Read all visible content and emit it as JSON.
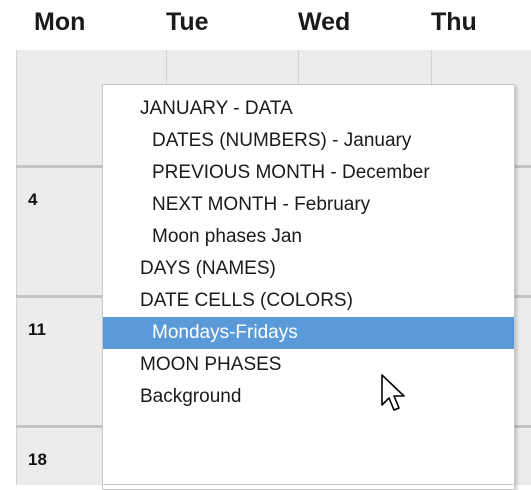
{
  "header": {
    "days": [
      "Mon",
      "Tue",
      "Wed",
      "Thu"
    ]
  },
  "calendar": {
    "date_numbers": [
      "4",
      "11",
      "18"
    ]
  },
  "context_menu": {
    "items": [
      {
        "label": "JANUARY - DATA",
        "level": 0,
        "selected": false
      },
      {
        "label": "DATES (NUMBERS) - January",
        "level": 1,
        "selected": false
      },
      {
        "label": "PREVIOUS MONTH - December",
        "level": 1,
        "selected": false
      },
      {
        "label": "NEXT MONTH - February",
        "level": 1,
        "selected": false
      },
      {
        "label": "Moon phases Jan",
        "level": 1,
        "selected": false
      },
      {
        "label": "DAYS (NAMES)",
        "level": 0,
        "selected": false
      },
      {
        "label": "DATE CELLS (COLORS)",
        "level": 0,
        "selected": false
      },
      {
        "label": "Mondays-Fridays",
        "level": 1,
        "selected": true
      },
      {
        "label": "MOON PHASES",
        "level": 0,
        "selected": false
      },
      {
        "label": "Background",
        "level": 0,
        "selected": false
      }
    ]
  },
  "colors": {
    "selection": "#5a9ad9",
    "calendar_bg": "#ececec"
  }
}
